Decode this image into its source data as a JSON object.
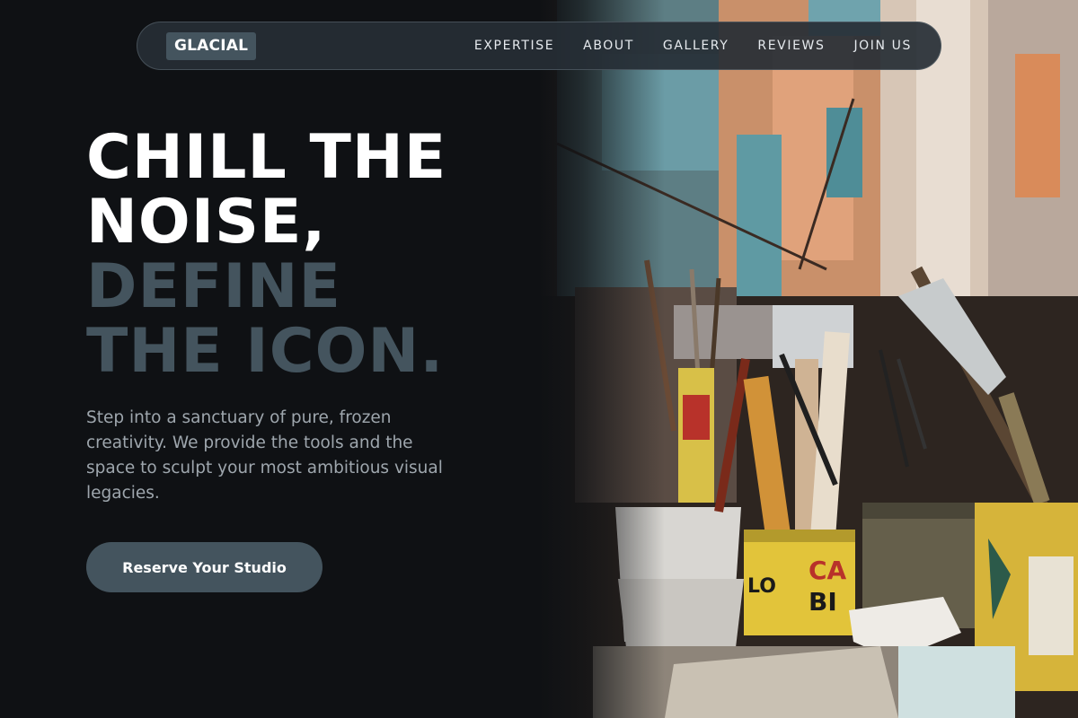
{
  "nav": {
    "logo": "GLACIAL",
    "links": [
      "EXPERTISE",
      "ABOUT",
      "GALLERY",
      "REVIEWS",
      "JOIN US"
    ]
  },
  "hero": {
    "headline_light": [
      "CHILL THE",
      "NOISE,"
    ],
    "headline_muted": [
      "DEFINE",
      "THE ICON."
    ],
    "subtext": "Step into a sanctuary of pure, frozen creativity. We provide the tools and the space to sculpt your most ambitious visual legacies.",
    "cta_label": "Reserve Your Studio",
    "image": "artist-brushes-in-paint-cans"
  },
  "colors": {
    "background": "#0f1114",
    "accent": "#44545e",
    "text_primary": "#ffffff",
    "text_secondary": "#9ea6ad"
  }
}
